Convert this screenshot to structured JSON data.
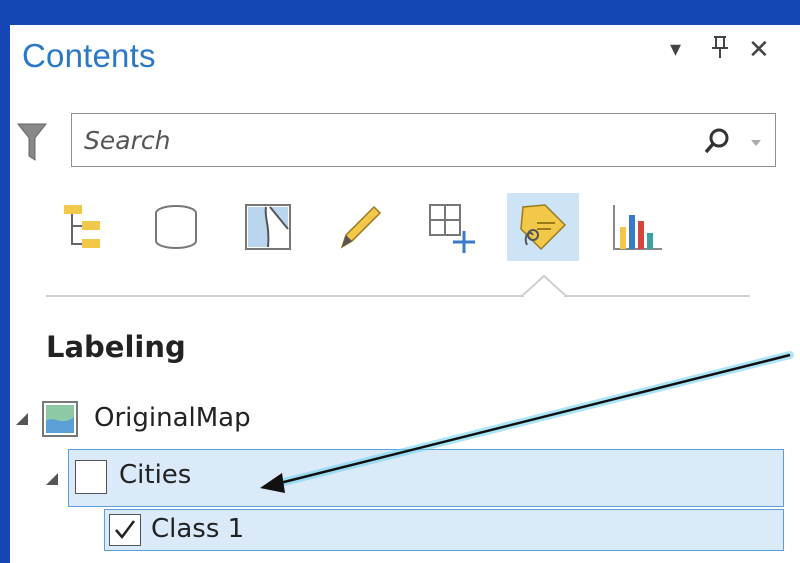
{
  "panel": {
    "title": "Contents",
    "controls": {
      "menu": "▾",
      "pin": "ᛘ",
      "close": "✕"
    }
  },
  "search": {
    "placeholder": "Search"
  },
  "toolbar": {
    "tools": [
      {
        "icon": "list-by-drawing-order-icon"
      },
      {
        "icon": "list-by-data-source-icon"
      },
      {
        "icon": "list-by-selection-icon"
      },
      {
        "icon": "list-by-editing-icon"
      },
      {
        "icon": "list-by-snapping-icon"
      },
      {
        "icon": "list-by-labeling-icon",
        "active": true
      },
      {
        "icon": "list-by-charts-icon"
      }
    ]
  },
  "section": {
    "title": "Labeling"
  },
  "tree": {
    "map": {
      "label": "OriginalMap"
    },
    "layer": {
      "label": "Cities",
      "checked": false
    },
    "class": {
      "label": "Class 1",
      "checked": true
    }
  },
  "colors": {
    "accent": "#2a78c8",
    "selection": "#dbeaf8",
    "selection_border": "#5aa0dc",
    "background": "#1446b4"
  }
}
